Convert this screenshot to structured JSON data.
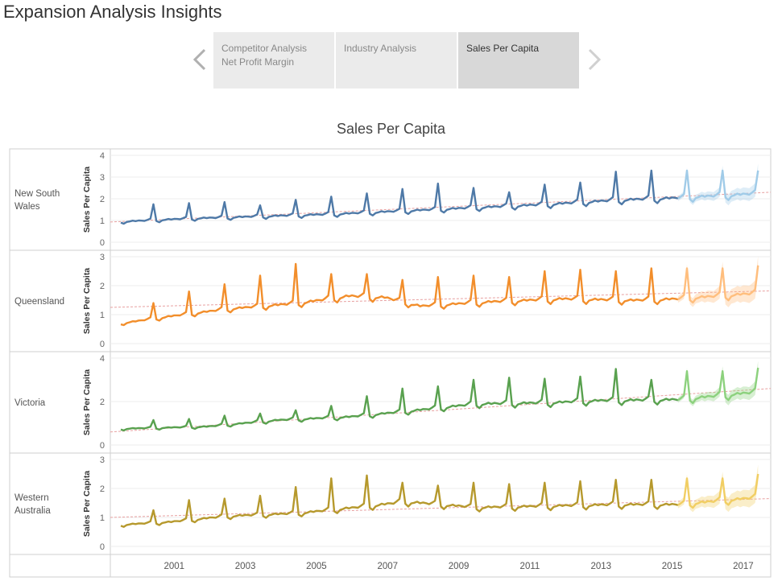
{
  "header": {
    "title": "Expansion Analysis Insights"
  },
  "nav": {
    "prev_icon": "chevron-left-icon",
    "next_icon": "chevron-right-icon",
    "tabs": [
      {
        "line1": "Competitor Analysis",
        "line2": "Net Profit Margin",
        "active": false
      },
      {
        "line1": "Industry Analysis",
        "line2": "",
        "active": false
      },
      {
        "line1": "Sales Per Capita",
        "line2": "",
        "active": true
      }
    ]
  },
  "chart_data": {
    "type": "line",
    "title": "Sales Per Capita",
    "ylabel": "Sales Per Capita",
    "x_ticks": [
      "2001",
      "2003",
      "2005",
      "2007",
      "2009",
      "2011",
      "2013",
      "2015",
      "2017"
    ],
    "xlim": [
      "2000-01",
      "2018-01"
    ],
    "actual_range": [
      "2000-01",
      "2015-09"
    ],
    "forecast_range": [
      "2015-10",
      "2017-12"
    ],
    "grid": true,
    "legend": "none",
    "panels": [
      {
        "name": "New South Wales",
        "color": "#4e79a7",
        "forecast_color": "#a0cbe8",
        "ylim": [
          0,
          4
        ],
        "y_ticks": [
          0,
          1,
          2,
          3,
          4
        ],
        "base_points": [
          [
            "2000-01",
            0.95
          ],
          [
            "2002-01",
            1.1
          ],
          [
            "2004-01",
            1.2
          ],
          [
            "2006-01",
            1.3
          ],
          [
            "2008-01",
            1.45
          ],
          [
            "2010-01",
            1.6
          ],
          [
            "2012-01",
            1.75
          ],
          [
            "2014-01",
            1.95
          ],
          [
            "2015-09",
            2.05
          ],
          [
            "2017-12",
            2.25
          ]
        ],
        "dec_peaks": [
          1.75,
          1.8,
          1.85,
          1.7,
          1.95,
          2.1,
          2.25,
          2.45,
          2.7,
          2.5,
          2.3,
          2.65,
          2.75,
          3.25,
          3.3,
          3.3,
          3.3,
          3.3
        ],
        "trend": [
          0.93,
          2.3
        ]
      },
      {
        "name": "Queensland",
        "color": "#f28e2b",
        "forecast_color": "#ffbe7d",
        "ylim": [
          0,
          3
        ],
        "y_ticks": [
          0,
          1,
          2,
          3
        ],
        "base_points": [
          [
            "2000-01",
            0.7
          ],
          [
            "2001-06",
            0.95
          ],
          [
            "2003-01",
            1.2
          ],
          [
            "2005-01",
            1.4
          ],
          [
            "2006-06",
            1.65
          ],
          [
            "2007-06",
            1.6
          ],
          [
            "2008-06",
            1.3
          ],
          [
            "2010-06",
            1.45
          ],
          [
            "2012-06",
            1.55
          ],
          [
            "2014-06",
            1.5
          ],
          [
            "2015-09",
            1.55
          ],
          [
            "2017-12",
            1.75
          ]
        ],
        "dec_peaks": [
          1.4,
          1.8,
          2.05,
          2.35,
          2.75,
          2.4,
          2.4,
          2.2,
          2.3,
          2.35,
          2.3,
          2.5,
          2.55,
          2.5,
          2.6,
          2.6,
          2.6,
          2.7
        ],
        "trend": [
          1.25,
          1.82
        ]
      },
      {
        "name": "Victoria",
        "color": "#59a14f",
        "forecast_color": "#8cd17d",
        "ylim": [
          0,
          4
        ],
        "y_ticks": [
          0,
          2,
          4
        ],
        "base_points": [
          [
            "2000-01",
            0.75
          ],
          [
            "2002-06",
            0.85
          ],
          [
            "2004-06",
            1.15
          ],
          [
            "2006-06",
            1.3
          ],
          [
            "2008-01",
            1.55
          ],
          [
            "2010-01",
            1.9
          ],
          [
            "2012-01",
            1.95
          ],
          [
            "2013-06",
            2.05
          ],
          [
            "2015-09",
            2.1
          ],
          [
            "2017-12",
            2.45
          ]
        ],
        "dec_peaks": [
          1.15,
          1.2,
          1.35,
          1.45,
          1.6,
          1.8,
          2.25,
          2.6,
          2.7,
          3.0,
          3.1,
          3.05,
          3.15,
          3.5,
          3.0,
          3.4,
          3.4,
          3.55
        ],
        "trend": [
          0.6,
          2.6
        ]
      },
      {
        "name": "Western Australia",
        "color": "#b6992d",
        "forecast_color": "#f1ce63",
        "ylim": [
          0,
          3
        ],
        "y_ticks": [
          0,
          1,
          2,
          3
        ],
        "base_points": [
          [
            "2000-01",
            0.75
          ],
          [
            "2001-06",
            0.85
          ],
          [
            "2003-01",
            1.05
          ],
          [
            "2005-01",
            1.15
          ],
          [
            "2007-01",
            1.4
          ],
          [
            "2008-01",
            1.55
          ],
          [
            "2010-01",
            1.35
          ],
          [
            "2012-01",
            1.4
          ],
          [
            "2014-01",
            1.45
          ],
          [
            "2015-09",
            1.45
          ],
          [
            "2017-12",
            1.7
          ]
        ],
        "dec_peaks": [
          1.25,
          1.6,
          1.65,
          1.75,
          2.05,
          2.35,
          2.45,
          2.2,
          2.1,
          2.2,
          2.15,
          2.2,
          2.25,
          2.3,
          2.3,
          2.35,
          2.35,
          2.5
        ],
        "trend": [
          1.0,
          1.65
        ]
      }
    ]
  }
}
